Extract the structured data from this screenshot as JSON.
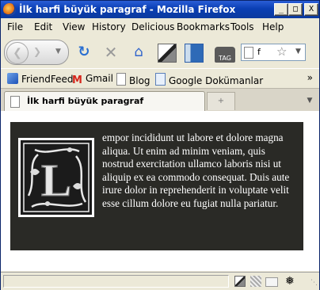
{
  "window": {
    "title": "İlk harfi büyük paragraf - Mozilla Firefox",
    "buttons": {
      "minimize": "_",
      "maximize": "□",
      "close": "X"
    }
  },
  "menubar": {
    "items": [
      {
        "label": "File"
      },
      {
        "label": "Edit"
      },
      {
        "label": "View"
      },
      {
        "label": "History"
      },
      {
        "label": "Delicious"
      },
      {
        "label": "Bookmarks"
      },
      {
        "label": "Tools"
      },
      {
        "label": "Help"
      }
    ]
  },
  "navbar": {
    "url_text": "f",
    "icons": [
      "back-icon",
      "forward-icon",
      "reload-icon",
      "stop-icon",
      "home-icon",
      "screenshot-icon",
      "sidebar-icon",
      "tag-icon",
      "bookmark-star-icon"
    ],
    "tag_label": "TAG"
  },
  "bookmarks": {
    "items": [
      {
        "label": "FriendFeed",
        "icon": "friendfeed-icon"
      },
      {
        "label": "Gmail",
        "icon": "gmail-icon"
      },
      {
        "label": "Blog",
        "icon": "page-icon"
      },
      {
        "label": "Google Dokümanlar",
        "icon": "docs-icon"
      }
    ],
    "more": "»"
  },
  "tabs": {
    "items": [
      {
        "label": "İlk harfi büyük paragraf",
        "active": true
      }
    ],
    "new_tab": "+"
  },
  "content": {
    "background": "#2a2a26",
    "text_color": "#ffffff",
    "drop_cap_letter": "L",
    "paragraph": "empor incididunt ut labore et dolore magna aliqua. Ut enim ad minim veniam, quis nostrud exercitation ullamco laboris nisi ut aliquip ex ea commodo consequat. Duis aute irure dolor in reprehenderit in voluptate velit esse cillum dolore eu fugiat nulla pariatur."
  },
  "statusbar": {
    "text": "",
    "icons": [
      "screenshot-icon",
      "grid-icon",
      "mail-icon",
      "bug-icon"
    ]
  }
}
